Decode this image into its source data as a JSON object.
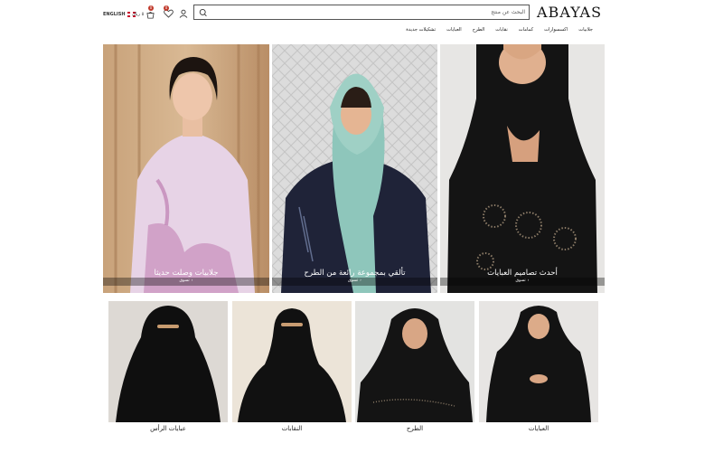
{
  "header": {
    "language": "ENGLISH",
    "cart_text": "٥ ريال",
    "cart_count": "0",
    "wishlist_count": "0",
    "search_placeholder": "البحث عن منتج",
    "logo": "ABAYAS"
  },
  "nav": {
    "items": [
      "تشكيلات جديدة",
      "العبايات",
      "الطرح",
      "نقابات",
      "كمامات",
      "اكسسوارات",
      "جلابيات"
    ]
  },
  "hero": [
    {
      "caption": "أحدث تصاميم العبايات",
      "more": "تسوق"
    },
    {
      "caption": "تألقي بمجموعة رائعة من الطرح",
      "more": "تسوق"
    },
    {
      "caption": "جلابيات وصلت حديثا",
      "more": "تسوق"
    }
  ],
  "categories": [
    {
      "label": "العبايات"
    },
    {
      "label": "الطرح"
    },
    {
      "label": "النقابات"
    },
    {
      "label": "عبايات الرأس"
    }
  ],
  "colors": {
    "badge": "#c0392b",
    "hero_overlay": "rgba(0,0,0,0.35)"
  }
}
